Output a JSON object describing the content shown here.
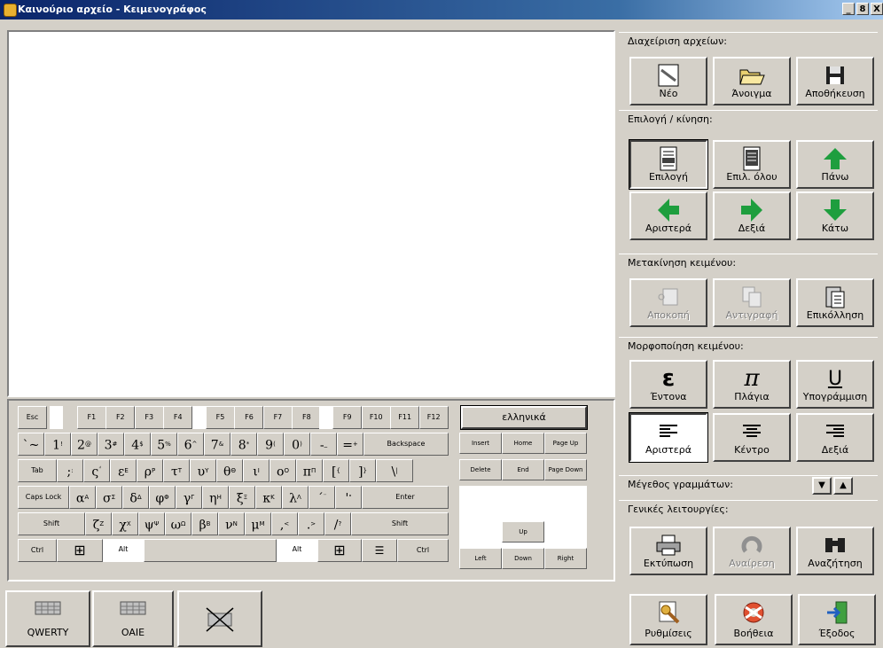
{
  "window": {
    "title": "Καινούριο αρχείο - Κειμενογράφος",
    "controls": [
      "_",
      "8",
      "X"
    ]
  },
  "editor": {
    "text": ""
  },
  "keyboard": {
    "language": "ελληνικά",
    "fn_row": [
      "Esc",
      "F1",
      "F2",
      "F3",
      "F4",
      "F5",
      "F6",
      "F7",
      "F8",
      "F9",
      "F10",
      "F11",
      "F12"
    ],
    "num_row": [
      {
        "main": "`~",
        "sup": ""
      },
      {
        "main": "1",
        "sup": "!"
      },
      {
        "main": "2",
        "sup": "@"
      },
      {
        "main": "3",
        "sup": "#"
      },
      {
        "main": "4",
        "sup": "$"
      },
      {
        "main": "5",
        "sup": "%"
      },
      {
        "main": "6",
        "sup": "^"
      },
      {
        "main": "7",
        "sup": "&"
      },
      {
        "main": "8",
        "sup": "*"
      },
      {
        "main": "9",
        "sup": "("
      },
      {
        "main": "0",
        "sup": ")"
      },
      {
        "main": "-",
        "sup": "_"
      },
      {
        "main": "=",
        "sup": "+"
      }
    ],
    "backspace": "Backspace",
    "tab": "Tab",
    "q_row": [
      {
        "main": ";",
        "sup": ":"
      },
      {
        "main": "ς",
        "sup": "΅"
      },
      {
        "main": "ε",
        "sup": "Ε"
      },
      {
        "main": "ρ",
        "sup": "Ρ"
      },
      {
        "main": "τ",
        "sup": "Τ"
      },
      {
        "main": "υ",
        "sup": "Υ"
      },
      {
        "main": "θ",
        "sup": "Θ"
      },
      {
        "main": "ι",
        "sup": "Ι"
      },
      {
        "main": "ο",
        "sup": "Ο"
      },
      {
        "main": "π",
        "sup": "Π"
      },
      {
        "main": "[",
        "sup": "{"
      },
      {
        "main": "]",
        "sup": "}"
      },
      {
        "main": "\\",
        "sup": "|"
      }
    ],
    "caps": "Caps Lock",
    "a_row": [
      {
        "main": "α",
        "sup": "Α"
      },
      {
        "main": "σ",
        "sup": "Σ"
      },
      {
        "main": "δ",
        "sup": "Δ"
      },
      {
        "main": "φ",
        "sup": "Φ"
      },
      {
        "main": "γ",
        "sup": "Γ"
      },
      {
        "main": "η",
        "sup": "Η"
      },
      {
        "main": "ξ",
        "sup": "Ξ"
      },
      {
        "main": "κ",
        "sup": "Κ"
      },
      {
        "main": "λ",
        "sup": "Λ"
      },
      {
        "main": "΄",
        "sup": "¨"
      },
      {
        "main": "'",
        "sup": "\""
      }
    ],
    "enter": "Enter",
    "shift": "Shift",
    "z_row": [
      {
        "main": "ζ",
        "sup": "Ζ"
      },
      {
        "main": "χ",
        "sup": "Χ"
      },
      {
        "main": "ψ",
        "sup": "Ψ"
      },
      {
        "main": "ω",
        "sup": "Ω"
      },
      {
        "main": "β",
        "sup": "Β"
      },
      {
        "main": "ν",
        "sup": "Ν"
      },
      {
        "main": "μ",
        "sup": "Μ"
      },
      {
        "main": ",",
        "sup": "<"
      },
      {
        "main": ".",
        "sup": ">"
      },
      {
        "main": "/",
        "sup": "?"
      }
    ],
    "ctrl": "Ctrl",
    "alt": "Alt",
    "nav": {
      "insert": "Insert",
      "home": "Home",
      "page_up": "Page Up",
      "delete": "Delete",
      "end": "End",
      "page_down": "Page Down",
      "up": "Up",
      "left": "Left",
      "down": "Down",
      "right": "Right"
    }
  },
  "layouts": {
    "qwerty": "QWERTY",
    "oaie": "OAIE"
  },
  "panel": {
    "files": {
      "title": "Διαχείριση αρχείων:",
      "new": "Νέο",
      "open": "Άνοιγμα",
      "save": "Αποθήκευση"
    },
    "select": {
      "title": "Επιλογή / κίνηση:",
      "select": "Επιλογή",
      "select_all": "Επιλ. όλου",
      "up": "Πάνω",
      "left": "Αριστερά",
      "right": "Δεξιά",
      "down": "Κάτω"
    },
    "move_text": {
      "title": "Μετακίνηση κειμένου:",
      "cut": "Αποκοπή",
      "copy": "Αντιγραφή",
      "paste": "Επικόλληση"
    },
    "format": {
      "title": "Μορφοποίηση κειμένου:",
      "bold": "Έντονα",
      "italic": "Πλάγια",
      "underline": "Υπογράμμιση",
      "bold_glyph": "ε",
      "italic_glyph": "π",
      "underline_glyph": "U",
      "align_left": "Αριστερά",
      "align_center": "Κέντρο",
      "align_right": "Δεξιά"
    },
    "font_size": {
      "title": "Μέγεθος γραμμάτων:"
    },
    "general": {
      "title": "Γενικές λειτουργίες:",
      "print": "Εκτύπωση",
      "undo": "Αναίρεση",
      "search": "Αναζήτηση"
    },
    "bottom": {
      "settings": "Ρυθμίσεις",
      "help": "Βοήθεια",
      "exit": "Έξοδος"
    }
  },
  "colors": {
    "accent_green": "#1e9e3e",
    "titlebar": "#0a246a"
  }
}
